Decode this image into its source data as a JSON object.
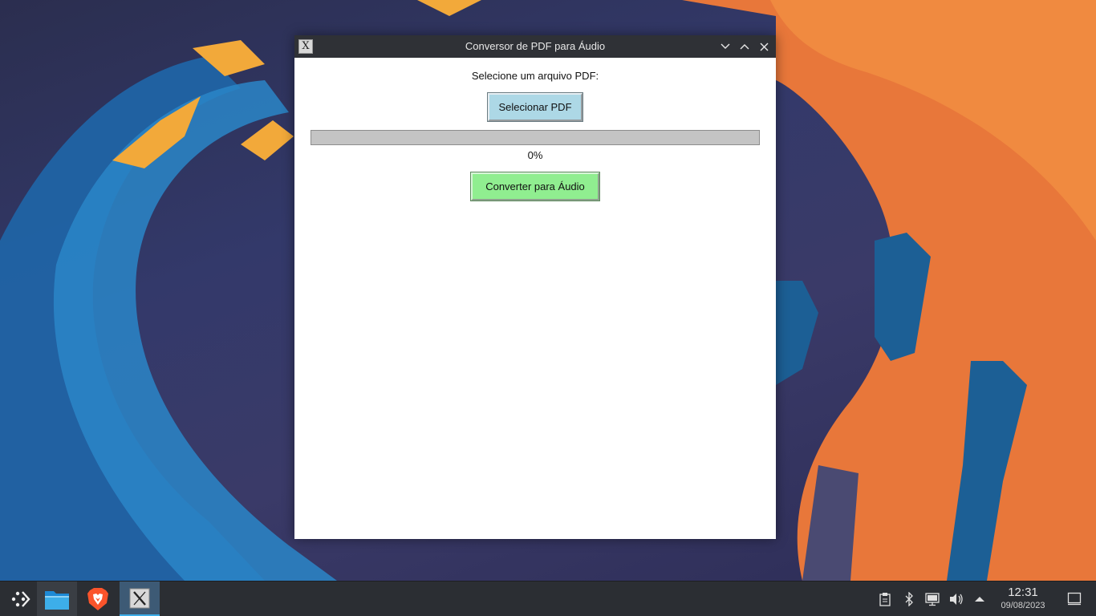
{
  "window": {
    "title": "Conversor de PDF para Áudio",
    "icon": "x-app-icon",
    "icon_glyph": "X"
  },
  "form": {
    "select_label": "Selecione um arquivo PDF:",
    "select_button": "Selecionar PDF",
    "progress_value": 0,
    "progress_text": "0%",
    "convert_button": "Converter para Áudio"
  },
  "taskbar": {
    "apps": [
      "application-launcher-icon",
      "file-manager-icon",
      "brave-browser-icon",
      "x-app-icon"
    ],
    "tray_icons": [
      "clipboard-icon",
      "bluetooth-icon",
      "network-icon",
      "volume-icon",
      "expand-tray-icon"
    ],
    "clock_time": "12:31",
    "clock_date": "09/08/2023"
  },
  "colors": {
    "select_button_bg": "#add8e6",
    "convert_button_bg": "#90ee90",
    "titlebar_bg": "#2f3136",
    "taskbar_bg": "#2b2e33"
  }
}
